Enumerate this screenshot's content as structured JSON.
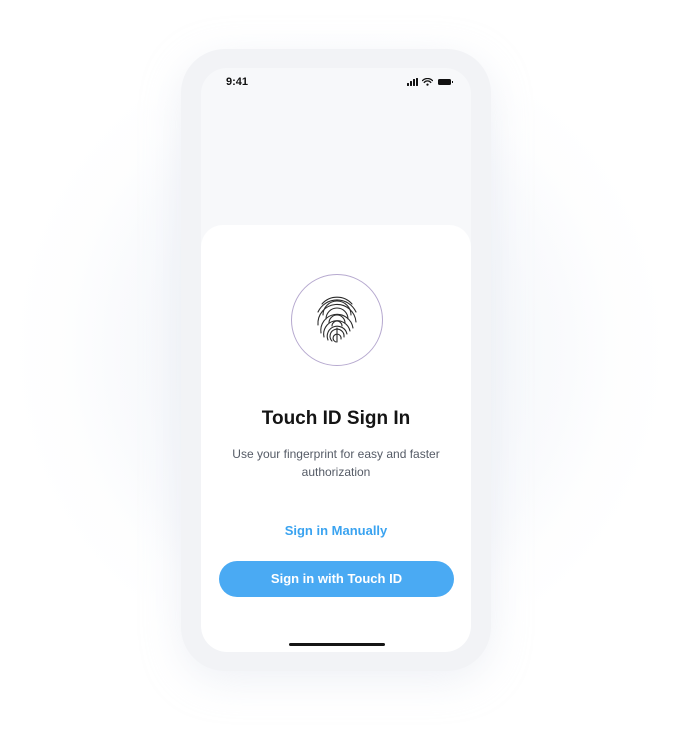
{
  "status_bar": {
    "time": "9:41",
    "icons": [
      "cellular-signal-icon",
      "wifi-icon",
      "battery-icon"
    ]
  },
  "auth_card": {
    "icon": "fingerprint-icon",
    "title": "Touch ID Sign In",
    "subtitle": "Use your fingerprint for easy and faster authorization",
    "manual_link_label": "Sign in Manually",
    "primary_button_label": "Sign in with Touch ID"
  },
  "colors": {
    "accent": "#4aaaf3",
    "link": "#3aa3f0",
    "fingerprint_ring": "#b6a9cf",
    "title_text": "#141414"
  }
}
